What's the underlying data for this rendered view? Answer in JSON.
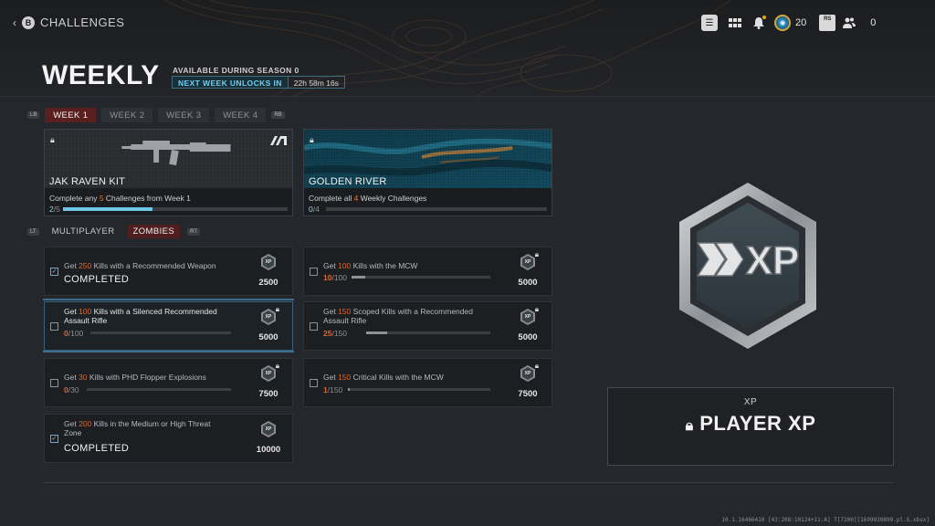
{
  "header": {
    "back_button": "B",
    "breadcrumb": "CHALLENGES",
    "title": "WEEKLY",
    "availability": "AVAILABLE DURING SEASON 0",
    "unlock_label": "NEXT WEEK UNLOCKS IN",
    "unlock_timer": "22h 58m 16s"
  },
  "toolbar": {
    "cod_points": "20",
    "rs_label": "RS",
    "party_count": "0"
  },
  "week_tabs": {
    "left_key": "LB",
    "right_key": "RB",
    "tabs": [
      "WEEK 1",
      "WEEK 2",
      "WEEK 3",
      "WEEK 4"
    ],
    "active_index": 0
  },
  "rewards": [
    {
      "name": "JAK RAVEN KIT",
      "desc_pre": "Complete any ",
      "desc_hl": "5",
      "desc_post": " Challenges from Week 1",
      "progress": "2",
      "total": "/5",
      "fraction": 0.4
    },
    {
      "name": "GOLDEN RIVER",
      "desc_pre": "Complete all ",
      "desc_hl": "4",
      "desc_post": " Weekly Challenges",
      "progress": "0",
      "total": "/4",
      "fraction": 0.0
    }
  ],
  "mode_tabs": {
    "left_key": "LT",
    "right_key": "RT",
    "tabs": [
      "MULTIPLAYER",
      "ZOMBIES"
    ],
    "active_index": 1
  },
  "challenges": [
    {
      "pre": "Get ",
      "hl": "250",
      "post": " Kills with a Recommended Weapon",
      "status": "COMPLETED",
      "xp": "2500"
    },
    {
      "pre": "Get ",
      "hl": "100",
      "post": " Kills with the MCW",
      "cur": "10",
      "tot": "/100",
      "fraction": 0.1,
      "xp": "5000"
    },
    {
      "pre": "Get ",
      "hl": "100",
      "post": " Kills with a Silenced Recommended Assault Rifle",
      "cur": "0",
      "tot": "/100",
      "fraction": 0.0,
      "xp": "5000"
    },
    {
      "pre": "Get ",
      "hl": "150",
      "post": " Scoped Kills with a Recommended Assault Rifle",
      "cur": "25",
      "tot": "/150",
      "fraction": 0.17,
      "xp": "5000"
    },
    {
      "pre": "Get ",
      "hl": "30",
      "post": " Kills with PHD Flopper Explosions",
      "cur": "0",
      "tot": "/30",
      "fraction": 0.0,
      "xp": "7500"
    },
    {
      "pre": "Get ",
      "hl": "150",
      "post": " Critical Kills with the MCW",
      "cur": "1",
      "tot": "/150",
      "fraction": 0.01,
      "xp": "7500"
    },
    {
      "pre": "Get ",
      "hl": "200",
      "post": " Kills in the Medium or High Threat Zone",
      "status": "COMPLETED",
      "xp": "10000"
    }
  ],
  "xp_icon_label": "XP",
  "badge_label": "XP",
  "detail": {
    "label": "XP",
    "title": "PLAYER XP"
  },
  "build_info": "10.1.16466410 [43:208:10124+11:A] T[7200][1699939899.pl.G.xbsx]",
  "colors": {
    "accent_orange": "#e0662a",
    "accent_cyan": "#6fc7e6",
    "active_tab": "#5a1f1f"
  }
}
